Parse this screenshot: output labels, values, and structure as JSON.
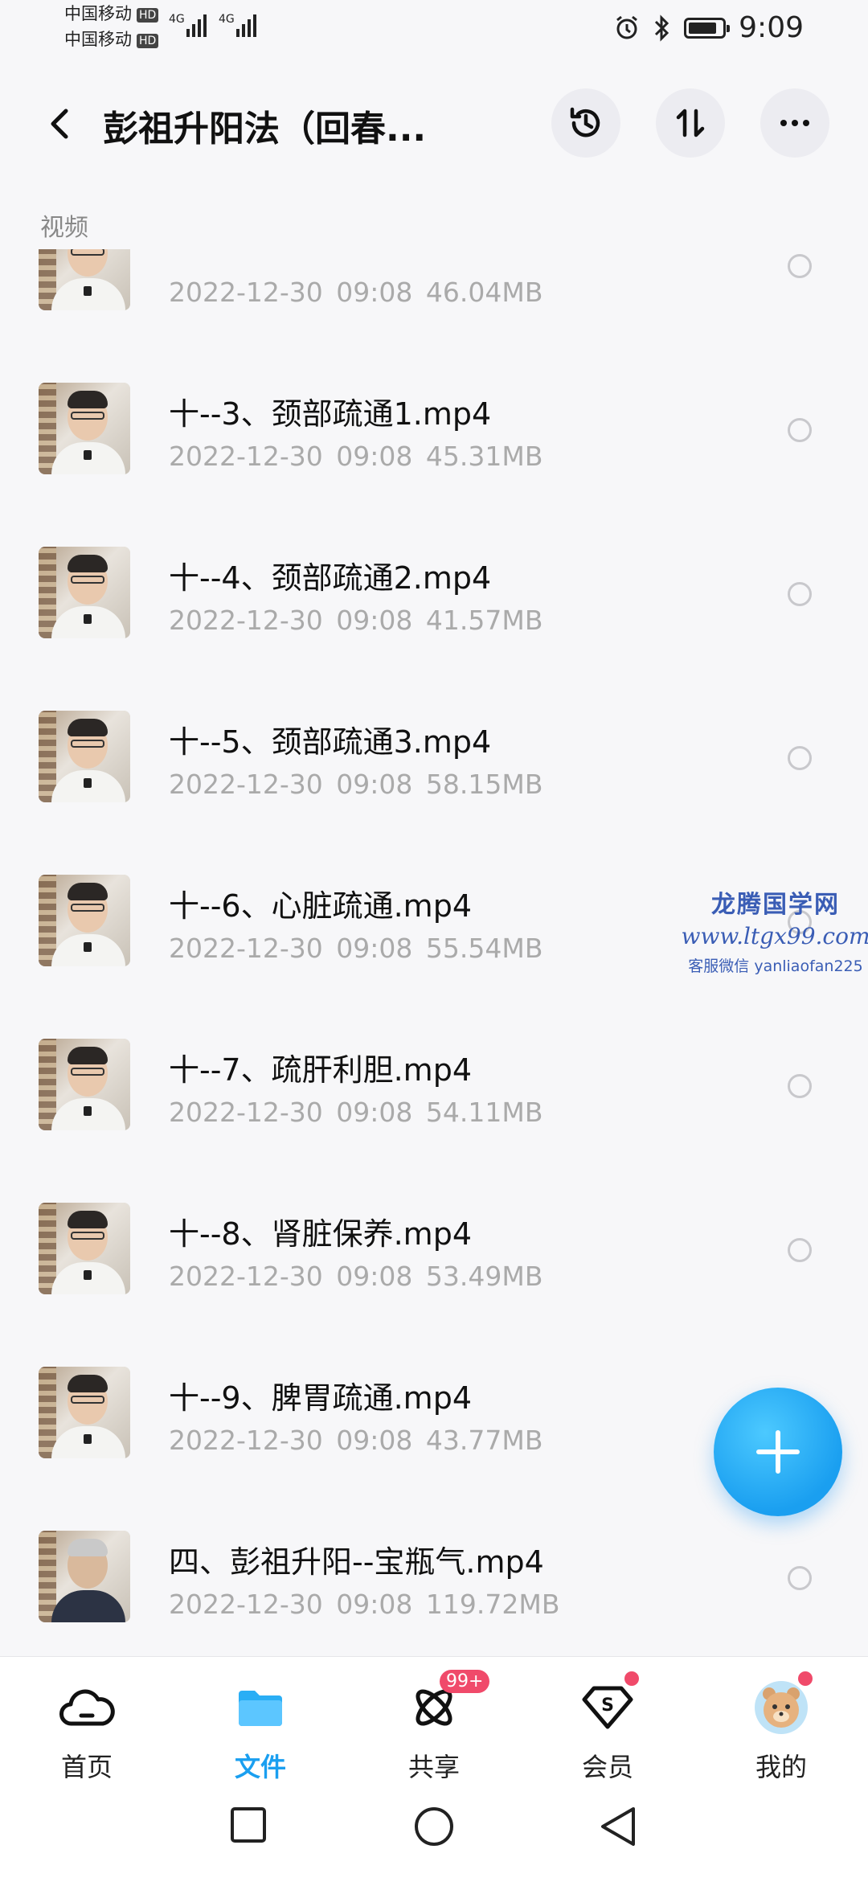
{
  "status_bar": {
    "carrier1": "中国移动",
    "carrier2": "中国移动",
    "hd": "HD",
    "net": "4G",
    "time": "9:09",
    "battery_level": 0.85
  },
  "header": {
    "title": "彭祖升阳法（回春...",
    "icons": [
      "history-icon",
      "sort-icon",
      "more-icon"
    ]
  },
  "section_label": "视频",
  "files": [
    {
      "name": "",
      "date": "2022-12-30",
      "time": "09:08",
      "size": "46.04MB"
    },
    {
      "name": "十--3、颈部疏通1.mp4",
      "date": "2022-12-30",
      "time": "09:08",
      "size": "45.31MB"
    },
    {
      "name": "十--4、颈部疏通2.mp4",
      "date": "2022-12-30",
      "time": "09:08",
      "size": "41.57MB"
    },
    {
      "name": "十--5、颈部疏通3.mp4",
      "date": "2022-12-30",
      "time": "09:08",
      "size": "58.15MB"
    },
    {
      "name": "十--6、心脏疏通.mp4",
      "date": "2022-12-30",
      "time": "09:08",
      "size": "55.54MB"
    },
    {
      "name": "十--7、疏肝利胆.mp4",
      "date": "2022-12-30",
      "time": "09:08",
      "size": "54.11MB"
    },
    {
      "name": "十--8、肾脏保养.mp4",
      "date": "2022-12-30",
      "time": "09:08",
      "size": "53.49MB"
    },
    {
      "name": "十--9、脾胃疏通.mp4",
      "date": "2022-12-30",
      "time": "09:08",
      "size": "43.77MB"
    },
    {
      "name": "四、彭祖升阳--宝瓶气.mp4",
      "date": "2022-12-30",
      "time": "09:08",
      "size": "119.72MB"
    }
  ],
  "watermark": {
    "line1": "龙腾国学网",
    "line2": "www.ltgx99.com",
    "line3": "客服微信 yanliaofan225"
  },
  "bottom_nav": {
    "tabs": [
      {
        "label": "首页",
        "icon": "cloud-icon"
      },
      {
        "label": "文件",
        "icon": "folder-icon"
      },
      {
        "label": "共享",
        "icon": "atom-icon",
        "badge": "99+"
      },
      {
        "label": "会员",
        "icon": "vip-diamond-icon"
      },
      {
        "label": "我的",
        "icon": "avatar-icon"
      }
    ]
  },
  "colors": {
    "accent": "#1a9ff0",
    "badge": "#f04a6a",
    "meta_text": "#aaaaaa"
  }
}
